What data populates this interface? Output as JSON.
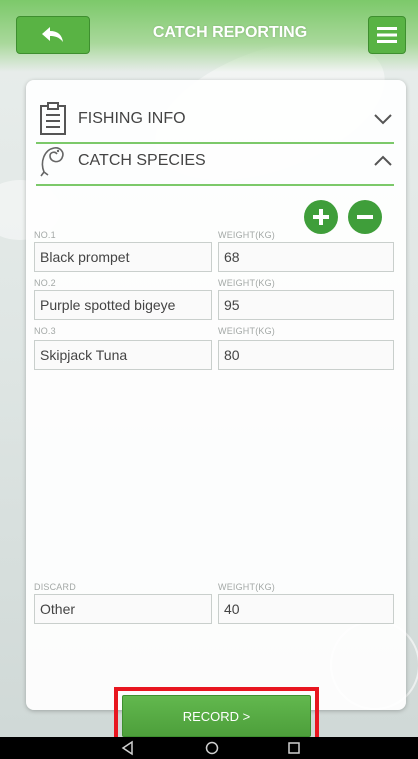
{
  "header": {
    "title": "CATCH REPORTING",
    "back_icon": "back-arrow-icon",
    "menu_icon": "hamburger-menu-icon"
  },
  "sections": {
    "fishing_info": {
      "label": "FISHING INFO",
      "icon": "clipboard-icon",
      "chevron": "chevron-down-icon"
    },
    "catch_species": {
      "label": "CATCH SPECIES",
      "icon": "fish-icon",
      "chevron": "chevron-up-icon"
    }
  },
  "controls": {
    "add_icon": "plus-circle-icon",
    "remove_icon": "minus-circle-icon"
  },
  "catch_rows": [
    {
      "no_label": "NO.1",
      "species": "Black prompet",
      "weight_label": "WEIGHT(KG)",
      "weight": "68"
    },
    {
      "no_label": "NO.2",
      "species": "Purple spotted bigeye",
      "weight_label": "WEIGHT(KG)",
      "weight": "95"
    },
    {
      "no_label": "NO.3",
      "species": "Skipjack Tuna",
      "weight_label": "WEIGHT(KG)",
      "weight": "80"
    }
  ],
  "discard": {
    "label": "DISCARD",
    "value": "Other",
    "weight_label": "WEIGHT(KG)",
    "weight": "40"
  },
  "record_button": {
    "label": "RECORD >"
  },
  "colors": {
    "accent_green": "#59b344",
    "highlight_red": "#e8161f"
  },
  "android_nav": {
    "back_icon": "nav-back-triangle-icon",
    "home_icon": "nav-home-circle-icon",
    "recents_icon": "nav-recents-square-icon"
  }
}
